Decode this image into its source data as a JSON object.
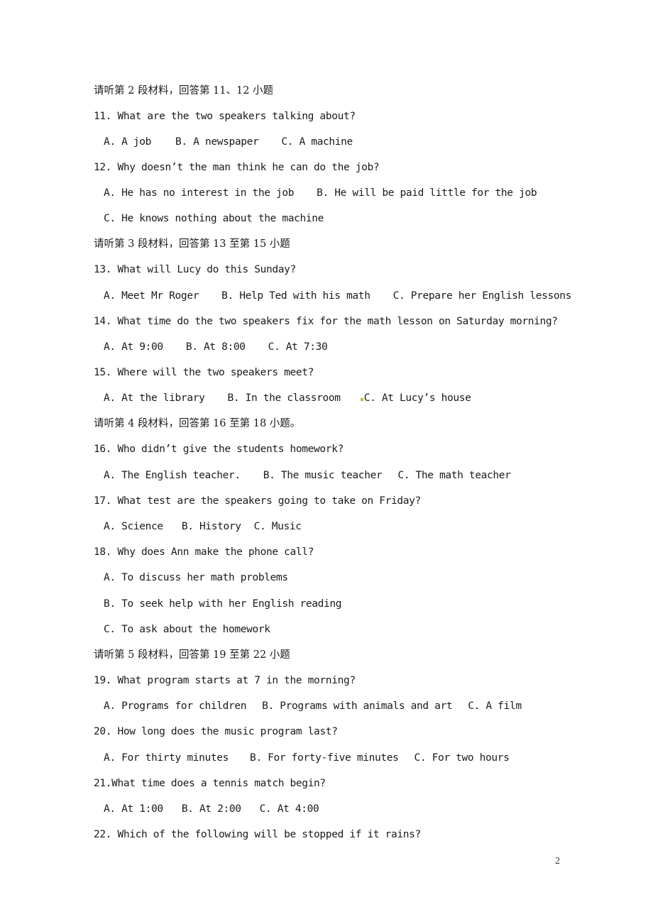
{
  "sections": [
    {
      "heading": "请听第 2 段材料，回答第 11、12 小题",
      "questions": [
        {
          "stem": "11. What are the two speakers talking about?",
          "option_lines": [
            [
              "A. A job",
              "B. A newspaper",
              "C. A machine"
            ]
          ]
        },
        {
          "stem": "12. Why doesn’t the man think he can do the job?",
          "option_lines": [
            [
              "A. He has no interest in the job",
              "B. He will be paid little for the job"
            ],
            [
              "C. He knows nothing about the machine"
            ]
          ]
        }
      ]
    },
    {
      "heading": "请听第 3 段材料，回答第 13 至第 15 小题",
      "questions": [
        {
          "stem": "13. What will Lucy do this Sunday?",
          "option_lines": [
            [
              "A. Meet Mr Roger",
              "B. Help Ted with his math",
              "C. Prepare her English lessons"
            ]
          ]
        },
        {
          "stem": "14. What time do the two speakers fix for the math lesson on Saturday morning?",
          "option_lines": [
            [
              "A. At 9:00",
              "B. At 8:00",
              "C. At 7:30"
            ]
          ]
        },
        {
          "stem": "15. Where will the two speakers meet?",
          "option_lines": [
            [
              "A. At the library",
              "B. In the classroom",
              "C. At Lucy’s house"
            ]
          ]
        }
      ]
    },
    {
      "heading": "请听第 4 段材料，回答第 16 至第 18 小题。",
      "questions": [
        {
          "stem": "16. Who didn’t give the students homework?",
          "option_lines": [
            [
              "A. The English teacher.",
              "B. The music teacher",
              "C. The math teacher"
            ]
          ]
        },
        {
          "stem": "17. What test are the speakers going to take on Friday?",
          "option_lines": [
            [
              "A. Science",
              "B. History",
              "C. Music"
            ]
          ]
        },
        {
          "stem": "18. Why does Ann make the phone call?",
          "option_lines": [
            [
              "A. To discuss her math problems"
            ],
            [
              "B. To seek help with her English reading"
            ],
            [
              "C. To ask about the homework"
            ]
          ]
        }
      ]
    },
    {
      "heading": "请听第 5 段材料，回答第 19 至第 22 小题",
      "questions": [
        {
          "stem": "19. What program starts at 7 in the morning?",
          "option_lines": [
            [
              "A. Programs for children",
              "B. Programs with animals and art",
              "C. A film"
            ]
          ]
        },
        {
          "stem": "20. How long does the music program last?",
          "option_lines": [
            [
              "A. For thirty minutes",
              "B. For forty-five minutes",
              "C. For two hours"
            ]
          ]
        },
        {
          "stem": "21.What time does a tennis match begin?",
          "option_lines": [
            [
              "A. At 1:00",
              "B. At 2:00",
              "C. At 4:00"
            ]
          ]
        },
        {
          "stem": "22. Which of the following will be stopped if it rains?",
          "option_lines": []
        }
      ]
    }
  ],
  "page_number": "2"
}
